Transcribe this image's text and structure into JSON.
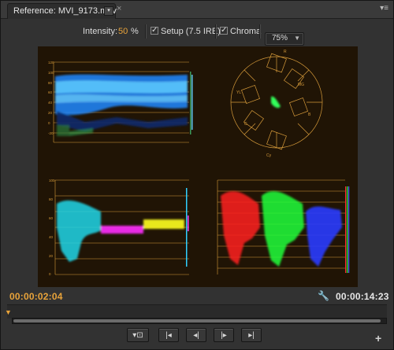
{
  "tab": {
    "title": "Reference: MVI_9173.mov",
    "menu_icon": "chevron-down-icon",
    "close": "×"
  },
  "panel_menu": "▾≡",
  "toolbar": {
    "intensity_label": "Intensity:",
    "intensity_value": "50",
    "intensity_unit": "%",
    "setup_label": "Setup (7.5 IRE)",
    "setup_checked": true,
    "chroma_label": "Chroma",
    "chroma_checked": true,
    "zoom_value": "75%"
  },
  "timeline": {
    "current_time": "00:00:02:04",
    "duration": "00:00:14:23",
    "current_time_color": "#e8a33a",
    "duration_color": "#e6e6e6",
    "progress": 0.0
  },
  "transport": {
    "button_symbols": [
      "▾⊡",
      "|◂",
      "◂|",
      "|▸",
      "▸|"
    ],
    "button_names": [
      "export-frame-button",
      "go-to-in-point-button",
      "step-back-button",
      "step-forward-button",
      "go-to-out-point-button"
    ],
    "add_symbol": "+"
  },
  "scopes": {
    "waveform_labels": [
      "120",
      "100",
      "80",
      "60",
      "40",
      "20",
      "0",
      "-20"
    ],
    "vectorscope_labels": [
      "R",
      "MG",
      "B",
      "Cy",
      "G",
      "YL"
    ],
    "rgb_labels": [
      "100",
      "80",
      "60",
      "40",
      "20",
      "0"
    ],
    "trace_color": "#d59a3a",
    "background": "#201405"
  }
}
